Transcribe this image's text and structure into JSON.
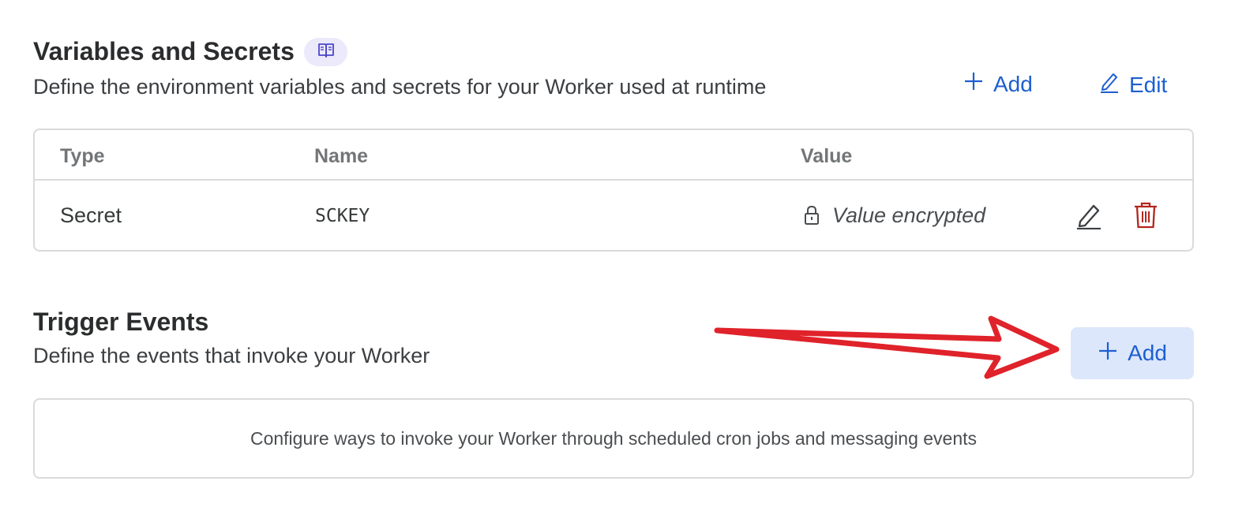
{
  "variables": {
    "title": "Variables and Secrets",
    "doc_icon": "book-icon",
    "description": "Define the environment variables and secrets for your Worker used at runtime",
    "add_label": "Add",
    "edit_label": "Edit",
    "columns": [
      "Type",
      "Name",
      "Value"
    ],
    "rows": [
      {
        "type": "Secret",
        "name": "SCKEY",
        "value": "Value encrypted"
      }
    ]
  },
  "triggers": {
    "title": "Trigger Events",
    "description": "Define the events that invoke your Worker",
    "add_label": "Add",
    "empty_message": "Configure ways to invoke your Worker through scheduled cron jobs and messaging events"
  },
  "colors": {
    "link": "#1d5fd1",
    "primary_bg": "#dce7fb",
    "delete": "#b3261e",
    "annotation_arrow": "#e0222a",
    "badge_bg": "#ece9fb"
  }
}
